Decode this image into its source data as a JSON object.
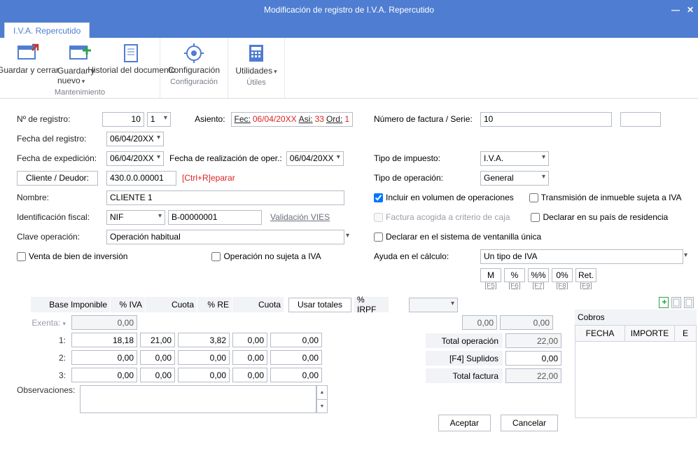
{
  "titlebar": {
    "title": "Modificación de registro de I.V.A. Repercutido"
  },
  "ribbon": {
    "tab": "I.V.A. Repercutido",
    "btn_save_close": "Guardar y cerrar",
    "btn_save_new": "Guardar y nuevo",
    "btn_history": "Historial del documento",
    "grp_mant": "Mantenimiento",
    "btn_config": "Configuración",
    "grp_config": "Configuración",
    "btn_utils": "Utilidades",
    "grp_utils": "Útiles"
  },
  "left": {
    "n_registro_lbl": "Nº de registro:",
    "n_registro_val": "10",
    "n_registro_serie": "1",
    "asiento_lbl": "Asiento:",
    "asiento_fec_k": "Fec:",
    "asiento_fec_v": "06/04/20XX",
    "asiento_asi_k": "Asi:",
    "asiento_asi_v": "33",
    "asiento_ord_k": "Ord:",
    "asiento_ord_v": "1",
    "fecha_reg_lbl": "Fecha del registro:",
    "fecha_reg_val": "06/04/20XX",
    "fecha_exp_lbl": "Fecha de expedición:",
    "fecha_exp_val": "06/04/20XX",
    "fecha_oper_lbl": "Fecha de realización de oper.:",
    "fecha_oper_val": "06/04/20XX",
    "cliente_btn": "Cliente / Deudor:",
    "cliente_val": "430.0.0.00001",
    "reparar": "[Ctrl+R]eparar",
    "nombre_lbl": "Nombre:",
    "nombre_val": "CLIENTE 1",
    "idfiscal_lbl": "Identificación fiscal:",
    "idfiscal_tipo": "NIF",
    "idfiscal_val": "B-00000001",
    "vies": "Validación VIES",
    "clave_lbl": "Clave operación:",
    "clave_val": "Operación habitual",
    "chk_venta": "Venta de bien de inversión",
    "chk_nosujeta": "Operación no sujeta a IVA"
  },
  "right": {
    "numfac_lbl": "Número de factura / Serie:",
    "numfac_val": "10",
    "tipoimp_lbl": "Tipo de impuesto:",
    "tipoimp_val": "I.V.A.",
    "tipoop_lbl": "Tipo de operación:",
    "tipoop_val": "General",
    "chk_incluir": "Incluir en volumen de operaciones",
    "chk_transm": "Transmisión de inmueble sujeta a IVA",
    "chk_caja": "Factura acogida a criterio de caja",
    "chk_pais": "Declarar en su país de residencia",
    "chk_ventanilla": "Declarar en el sistema de ventanilla única",
    "ayuda_lbl": "Ayuda en el cálculo:",
    "ayuda_val": "Un tipo de IVA",
    "mb_m": "M",
    "mb_pct": "%",
    "mb_pp": "%%",
    "mb_0": "0%",
    "mb_ret": "Ret.",
    "k5": "[F5]",
    "k6": "[F6]",
    "k7": "[F7]",
    "k8": "[F8]",
    "k9": "[F9]"
  },
  "grid": {
    "h_base": "Base Imponible",
    "h_piva": "% IVA",
    "h_cuota": "Cuota",
    "h_pre": "% RE",
    "h_cuota2": "Cuota",
    "usar_totales": "Usar totales",
    "h_irpf": "% IRPF",
    "exenta_lbl": "Exenta:",
    "r1": "1:",
    "r2": "2:",
    "r3": "3:",
    "exenta_base": "0,00",
    "r1v": {
      "base": "18,18",
      "piva": "21,00",
      "cuota": "3,82",
      "pre": "0,00",
      "cuota2": "0,00"
    },
    "r2v": {
      "base": "0,00",
      "piva": "0,00",
      "cuota": "0,00",
      "pre": "0,00",
      "cuota2": "0,00"
    },
    "r3v": {
      "base": "0,00",
      "piva": "0,00",
      "cuota": "0,00",
      "pre": "0,00",
      "cuota2": "0,00"
    },
    "irpf_zero": "0,00",
    "irpf_val": "0,00",
    "obs_lbl": "Observaciones:",
    "tot_op_lbl": "Total operación",
    "tot_op": "22,00",
    "supl_lbl": "[F4] Suplidos",
    "supl": "0,00",
    "tot_fac_lbl": "Total factura",
    "tot_fac": "22,00",
    "aceptar": "Aceptar",
    "cancelar": "Cancelar"
  },
  "cobros": {
    "title": "Cobros",
    "th_fecha": "FECHA",
    "th_importe": "IMPORTE",
    "th_e": "E"
  }
}
